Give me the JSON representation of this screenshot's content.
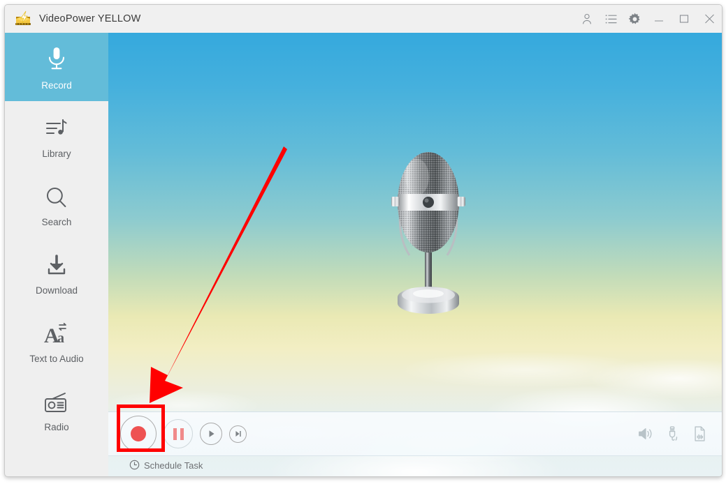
{
  "window": {
    "title": "VideoPower YELLOW",
    "app_icon": "videopower-app-icon",
    "controls": {
      "account": "account-icon",
      "list": "list-icon",
      "settings": "gear-icon",
      "minimize": "minimize-icon",
      "maximize": "maximize-icon",
      "close": "close-icon"
    }
  },
  "sidebar": {
    "active_index": 0,
    "items": [
      {
        "label": "Record",
        "icon": "microphone-icon"
      },
      {
        "label": "Library",
        "icon": "library-music-icon"
      },
      {
        "label": "Search",
        "icon": "search-icon"
      },
      {
        "label": "Download",
        "icon": "download-icon"
      },
      {
        "label": "Text to Audio",
        "icon": "text-to-audio-icon"
      },
      {
        "label": "Radio",
        "icon": "radio-icon"
      }
    ]
  },
  "main": {
    "artwork": "vintage-microphone-illustration",
    "background": "sky-gradient-with-clouds"
  },
  "player": {
    "record_label": "Record",
    "pause_label": "Pause",
    "play_label": "Play",
    "next_label": "Next",
    "record_icon": "record-dot-icon",
    "pause_icon": "pause-icon",
    "play_icon": "play-icon",
    "next_icon": "skip-next-icon",
    "right_tools": [
      {
        "name": "speaker-volume-icon",
        "label": "Sound Source"
      },
      {
        "name": "audio-jack-icon",
        "label": "Microphone Source"
      },
      {
        "name": "audio-file-icon",
        "label": "Output Format"
      }
    ]
  },
  "schedule": {
    "label": "Schedule Task",
    "icon": "clock-icon"
  },
  "annotations": {
    "highlight_target": "record-button",
    "arrow_color": "#ff0000",
    "box_color": "#ff0000"
  },
  "colors": {
    "accent": "#63bcd9",
    "sky_top": "#35a9dd",
    "sky_warm": "#eae9b4",
    "record_red": "#ee5252",
    "pause_red": "#f08a8a",
    "sidebar_bg": "#efefef",
    "titlebar_bg": "#f0f0f0"
  }
}
